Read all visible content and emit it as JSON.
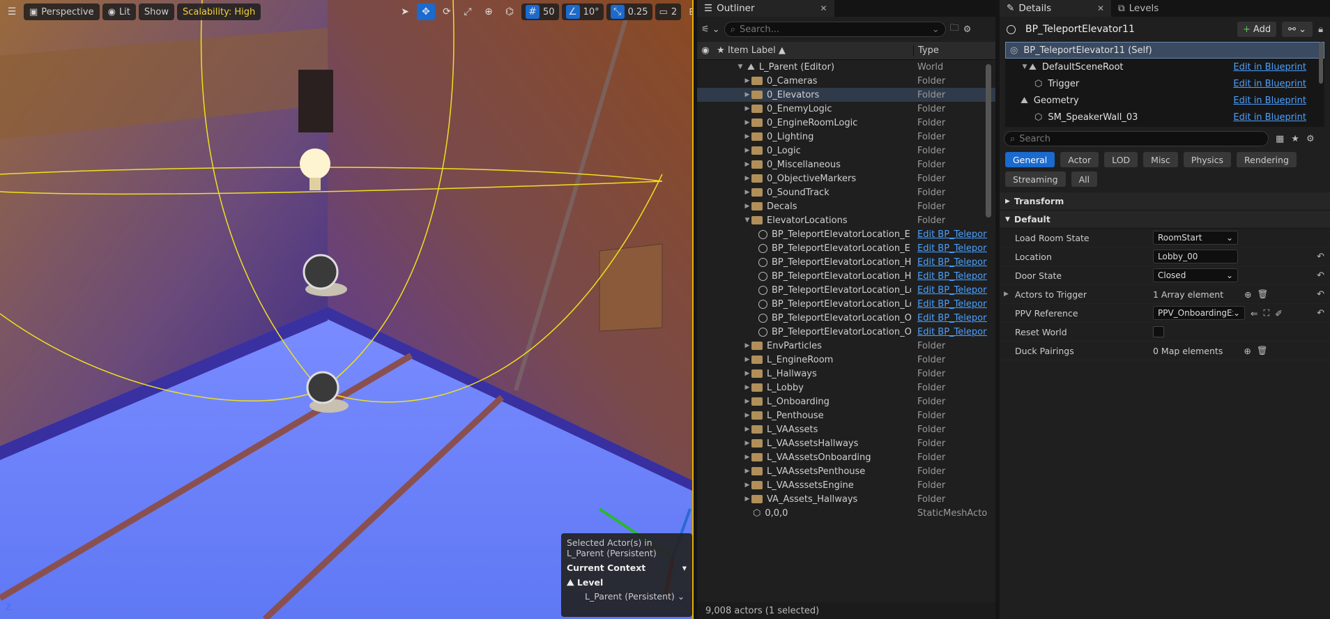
{
  "viewport": {
    "perspective_label": "Perspective",
    "lit_label": "Lit",
    "show_label": "Show",
    "scalability_label": "Scalability: High",
    "grid_snap": "50",
    "rotation_snap": "10°",
    "scale_snap": "0.25",
    "camera_speed": "2",
    "selection_info": {
      "line1": "Selected Actor(s) in",
      "line2": "L_Parent (Persistent)",
      "context_title": "Current Context",
      "level_label": "Level",
      "level_value": "L_Parent (Persistent)"
    },
    "axis_z": "Z"
  },
  "outliner": {
    "tab_title": "Outliner",
    "search_placeholder": "Search...",
    "col_label": "Item Label ▲",
    "col_type": "Type",
    "rows": [
      {
        "label": "L_Parent (Editor)",
        "type": "World"
      },
      {
        "label": "0_Cameras",
        "type": "Folder"
      },
      {
        "label": "0_Elevators",
        "type": "Folder"
      },
      {
        "label": "0_EnemyLogic",
        "type": "Folder"
      },
      {
        "label": "0_EngineRoomLogic",
        "type": "Folder"
      },
      {
        "label": "0_Lighting",
        "type": "Folder"
      },
      {
        "label": "0_Logic",
        "type": "Folder"
      },
      {
        "label": "0_Miscellaneous",
        "type": "Folder"
      },
      {
        "label": "0_ObjectiveMarkers",
        "type": "Folder"
      },
      {
        "label": "0_SoundTrack",
        "type": "Folder"
      },
      {
        "label": "Decals",
        "type": "Folder"
      },
      {
        "label": "ElevatorLocations",
        "type": "Folder"
      },
      {
        "label": "BP_TeleportElevatorLocation_Eng",
        "type": "Edit BP_Teleport"
      },
      {
        "label": "BP_TeleportElevatorLocation_Eng",
        "type": "Edit BP_Teleport"
      },
      {
        "label": "BP_TeleportElevatorLocation_Hal",
        "type": "Edit BP_Teleport"
      },
      {
        "label": "BP_TeleportElevatorLocation_Hal",
        "type": "Edit BP_Teleport"
      },
      {
        "label": "BP_TeleportElevatorLocation_Lob",
        "type": "Edit BP_Teleport"
      },
      {
        "label": "BP_TeleportElevatorLocation_Lob",
        "type": "Edit BP_Teleport"
      },
      {
        "label": "BP_TeleportElevatorLocation_Onl",
        "type": "Edit BP_Teleport"
      },
      {
        "label": "BP_TeleportElevatorLocation_Onl",
        "type": "Edit BP_Teleport"
      },
      {
        "label": "EnvParticles",
        "type": "Folder"
      },
      {
        "label": "L_EngineRoom",
        "type": "Folder"
      },
      {
        "label": "L_Hallways",
        "type": "Folder"
      },
      {
        "label": "L_Lobby",
        "type": "Folder"
      },
      {
        "label": "L_Onboarding",
        "type": "Folder"
      },
      {
        "label": "L_Penthouse",
        "type": "Folder"
      },
      {
        "label": "L_VAAssets",
        "type": "Folder"
      },
      {
        "label": "L_VAAssetsHallways",
        "type": "Folder"
      },
      {
        "label": "L_VAAssetsOnboarding",
        "type": "Folder"
      },
      {
        "label": "L_VAAssetsPenthouse",
        "type": "Folder"
      },
      {
        "label": "L_VAAsssetsEngine",
        "type": "Folder"
      },
      {
        "label": "VA_Assets_Hallways",
        "type": "Folder"
      },
      {
        "label": "0,0,0",
        "type": "StaticMeshActor"
      }
    ],
    "status": "9,008 actors (1 selected)"
  },
  "details": {
    "tab_title": "Details",
    "levels_tab": "Levels",
    "actor_name": "BP_TeleportElevator11",
    "add_label": "Add",
    "components": [
      {
        "label": "BP_TeleportElevator11 (Self)",
        "link": ""
      },
      {
        "label": "DefaultSceneRoot",
        "link": "Edit in Blueprint"
      },
      {
        "label": "Trigger",
        "link": "Edit in Blueprint"
      },
      {
        "label": "Geometry",
        "link": "Edit in Blueprint"
      },
      {
        "label": "SM_SpeakerWall_03",
        "link": "Edit in Blueprint"
      }
    ],
    "search_placeholder": "Search",
    "categories": [
      "General",
      "Actor",
      "LOD",
      "Misc",
      "Physics",
      "Rendering",
      "Streaming",
      "All"
    ],
    "section_transform": "Transform",
    "section_default": "Default",
    "props": {
      "load_room_state": {
        "name": "Load Room State",
        "value": "RoomStart"
      },
      "location": {
        "name": "Location",
        "value": "Lobby_00"
      },
      "door_state": {
        "name": "Door State",
        "value": "Closed"
      },
      "actors_to_trigger": {
        "name": "Actors to Trigger",
        "value": "1 Array element"
      },
      "ppv_reference": {
        "name": "PPV Reference",
        "value": "PPV_OnboardingExit"
      },
      "reset_world": {
        "name": "Reset World"
      },
      "duck_pairings": {
        "name": "Duck Pairings",
        "value": "0 Map elements"
      }
    }
  }
}
